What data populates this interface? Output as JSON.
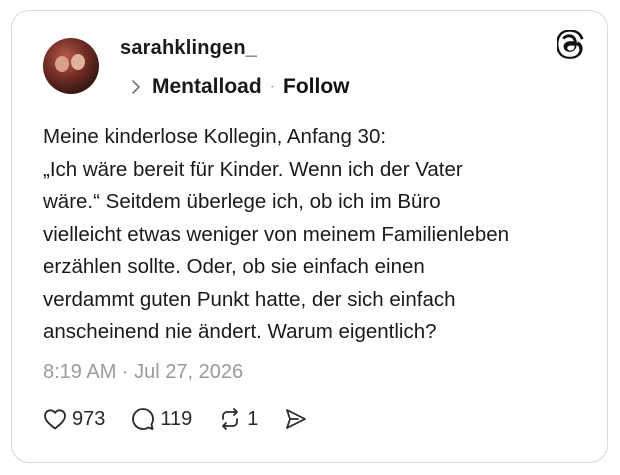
{
  "post": {
    "username": "sarahklingen_",
    "community": "Mentalload",
    "separator": "·",
    "follow_label": "Follow",
    "text": "Meine kinderlose Kollegin, Anfang 30:\n„Ich wäre bereit für Kinder. Wenn ich der Vater\nwäre.“ Seitdem überlege ich, ob ich im Büro\nvielleicht etwas weniger von meinem Familienleben\nerzählen sollte. Oder, ob sie einfach einen\nverdammt guten Punkt hatte, der sich einfach\nanscheinend nie ändert. Warum eigentlich?",
    "timestamp": "8:19 AM · Jul 27, 2026"
  },
  "actions": {
    "likes": "973",
    "replies": "119",
    "reposts": "1"
  },
  "icons": {
    "brand": "threads-logo-icon",
    "like": "heart-icon",
    "reply": "comment-icon",
    "repost": "repost-icon",
    "share": "send-icon",
    "breadcrumb": "chevron-right-icon"
  },
  "colors": {
    "text": "#1a1a1a",
    "muted": "#9a9a9a",
    "border": "#d9d9d9"
  }
}
